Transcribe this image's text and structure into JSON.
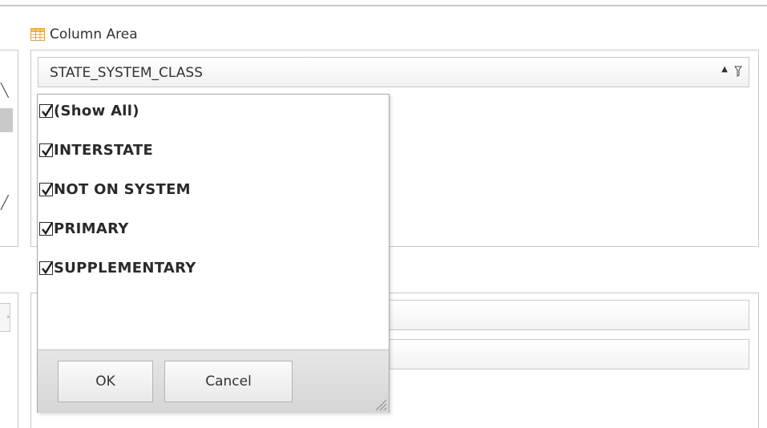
{
  "column_area": {
    "title": "Column Area",
    "field": {
      "name": "STATE_SYSTEM_CLASS"
    }
  },
  "filter_popup": {
    "items": [
      {
        "label": "(Show All)",
        "checked": true
      },
      {
        "label": "INTERSTATE",
        "checked": true
      },
      {
        "label": "NOT ON SYSTEM",
        "checked": true
      },
      {
        "label": "PRIMARY",
        "checked": true
      },
      {
        "label": "SUPPLEMENTARY",
        "checked": true
      }
    ],
    "ok_label": "OK",
    "cancel_label": "Cancel"
  },
  "icons": {
    "area": "table-grid-icon",
    "sort": "sort-ascending-icon",
    "filter": "filter-funnel-icon",
    "check": "checkmark-icon",
    "resize": "resize-grip-icon"
  },
  "colors": {
    "border": "#c8c8c8",
    "text": "#333333",
    "footer": "#dcdcdc",
    "table_icon_accent": "#e8a33d"
  }
}
